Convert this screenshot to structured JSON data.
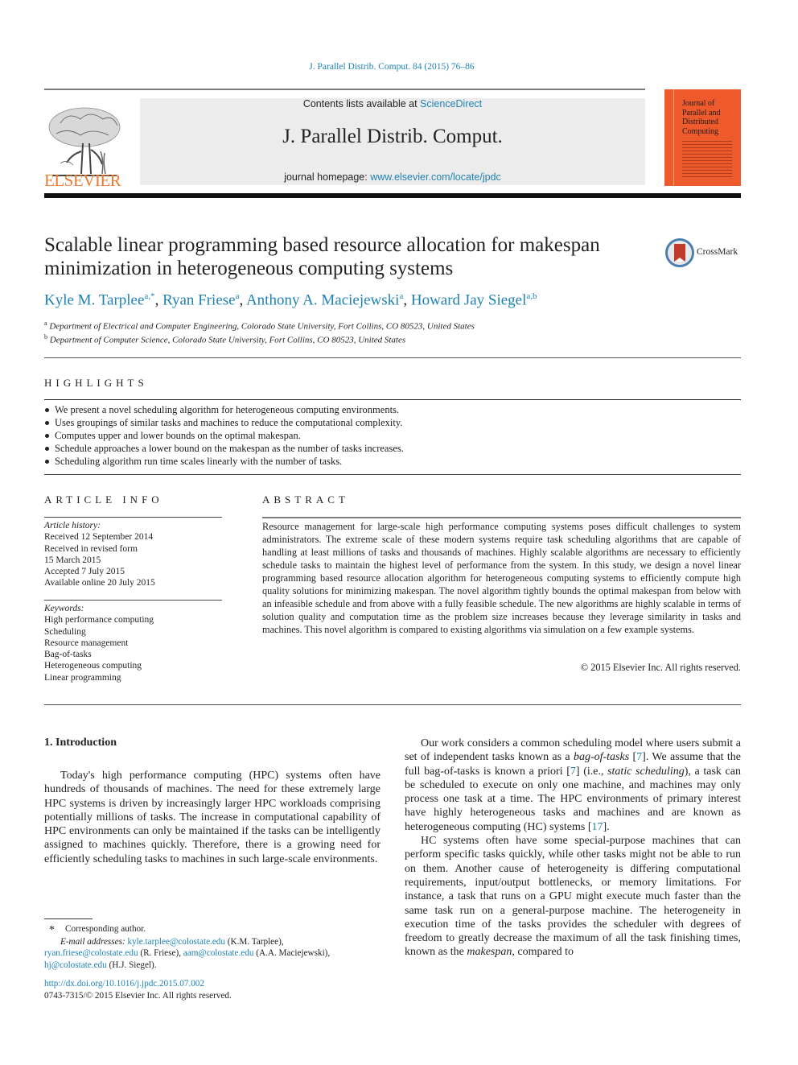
{
  "running_head": "J. Parallel Distrib. Comput. 84 (2015) 76–86",
  "masthead": {
    "contents_prefix": "Contents lists available at ",
    "contents_link": "ScienceDirect",
    "journal_title": "J. Parallel Distrib. Comput.",
    "homepage_prefix": "journal homepage: ",
    "homepage_link": "www.elsevier.com/locate/jpdc",
    "publisher_logo_text": "ELSEVIER",
    "cover_title_lines": [
      "Journal of",
      "Parallel and",
      "Distributed",
      "Computing"
    ]
  },
  "colors": {
    "link": "#1f82b4",
    "elsevier_orange": "#f07a2d",
    "cover_orange": "#ef5a2d",
    "masthead_gray": "#ececec"
  },
  "article": {
    "title": "Scalable linear programming based resource allocation for makespan minimization in heterogeneous computing systems",
    "crossmark_label": "CrossMark",
    "authors": [
      {
        "name": "Kyle M. Tarplee",
        "sup": "a,*"
      },
      {
        "name": "Ryan Friese",
        "sup": "a"
      },
      {
        "name": "Anthony A. Maciejewski",
        "sup": "a"
      },
      {
        "name": "Howard Jay Siegel",
        "sup": "a,b"
      }
    ],
    "affiliations": [
      {
        "key": "a",
        "text": "Department of Electrical and Computer Engineering, Colorado State University, Fort Collins, CO 80523, United States"
      },
      {
        "key": "b",
        "text": "Department of Computer Science, Colorado State University, Fort Collins, CO 80523, United States"
      }
    ]
  },
  "highlights": {
    "heading": "HIGHLIGHTS",
    "items": [
      "We present a novel scheduling algorithm for heterogeneous computing environments.",
      "Uses groupings of similar tasks and machines to reduce the computational complexity.",
      "Computes upper and lower bounds on the optimal makespan.",
      "Schedule approaches a lower bound on the makespan as the number of tasks increases.",
      "Scheduling algorithm run time scales linearly with the number of tasks."
    ]
  },
  "article_info": {
    "heading": "ARTICLE INFO",
    "history_label": "Article history:",
    "history": [
      "Received 12 September 2014",
      "Received in revised form",
      "15 March 2015",
      "Accepted 7 July 2015",
      "Available online 20 July 2015"
    ],
    "keywords_label": "Keywords:",
    "keywords": [
      "High performance computing",
      "Scheduling",
      "Resource management",
      "Bag-of-tasks",
      "Heterogeneous computing",
      "Linear programming"
    ]
  },
  "abstract": {
    "heading": "ABSTRACT",
    "text": "Resource management for large-scale high performance computing systems poses difficult challenges to system administrators. The extreme scale of these modern systems require task scheduling algorithms that are capable of handling at least millions of tasks and thousands of machines. Highly scalable algorithms are necessary to efficiently schedule tasks to maintain the highest level of performance from the system. In this study, we design a novel linear programming based resource allocation algorithm for heterogeneous computing systems to efficiently compute high quality solutions for minimizing makespan. The novel algorithm tightly bounds the optimal makespan from below with an infeasible schedule and from above with a fully feasible schedule. The new algorithms are highly scalable in terms of solution quality and computation time as the problem size increases because they leverage similarity in tasks and machines. This novel algorithm is compared to existing algorithms via simulation on a few example systems.",
    "copyright": "© 2015 Elsevier Inc. All rights reserved."
  },
  "body": {
    "section_heading": "1.  Introduction",
    "left_para": "Today's high performance computing (HPC) systems often have hundreds of thousands of machines. The need for these extremely large HPC systems is driven by increasingly larger HPC workloads comprising potentially millions of tasks. The increase in computational capability of HPC environments can only be maintained if the tasks can be intelligently assigned to machines quickly. Therefore, there is a growing need for efficiently scheduling tasks to machines in such large-scale environments.",
    "right_para1": {
      "t1": "Our work considers a common scheduling model where users submit a set of independent tasks known as a ",
      "em1": "bag-of-tasks",
      "t2": " [",
      "ref1": "7",
      "t3": "]. We assume that the full bag-of-tasks is known a priori [",
      "ref2": "7",
      "t4": "] (i.e., ",
      "em2": "static scheduling",
      "t5": "), a task can be scheduled to execute on only one machine, and machines may only process one task at a time. The HPC environments of primary interest have highly heterogeneous tasks and machines and are known as heterogeneous computing (HC) systems [",
      "ref3": "17",
      "t6": "]."
    },
    "right_para2": {
      "t1": "HC systems often have some special-purpose machines that can perform specific tasks quickly, while other tasks might not be able to run on them. Another cause of heterogeneity is differing computational requirements, input/output bottlenecks, or memory limitations. For instance, a task that runs on a GPU might execute much faster than the same task run on a general-purpose machine. The heterogeneity in execution time of the tasks provides the scheduler with degrees of freedom to greatly decrease the maximum of all the task finishing times, known as the ",
      "em1": "makespan",
      "t2": ", compared to"
    }
  },
  "footnotes": {
    "star": "*",
    "corresponding": "Corresponding author.",
    "email_label": "E-mail addresses:",
    "emails": [
      {
        "address": "kyle.tarplee@colostate.edu",
        "who": " (K.M. Tarplee),"
      },
      {
        "address": "ryan.friese@colostate.edu",
        "who": " (R. Friese), "
      },
      {
        "address": "aam@colostate.edu",
        "who": " (A.A. Maciejewski),"
      },
      {
        "address": "hj@colostate.edu",
        "who": " (H.J. Siegel)."
      }
    ],
    "doi": "http://dx.doi.org/10.1016/j.jpdc.2015.07.002",
    "issn_line": "0743-7315/© 2015 Elsevier Inc. All rights reserved."
  }
}
